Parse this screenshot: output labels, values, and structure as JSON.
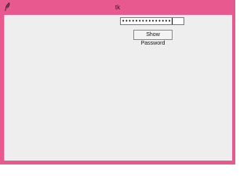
{
  "window": {
    "title": "tk",
    "app_icon": "feather-icon",
    "frame_color": "#e8598f",
    "client_bg": "#eeeeee"
  },
  "password_field": {
    "value": "•••••••••••••••"
  },
  "show_password_button": {
    "label": "Show Password"
  }
}
